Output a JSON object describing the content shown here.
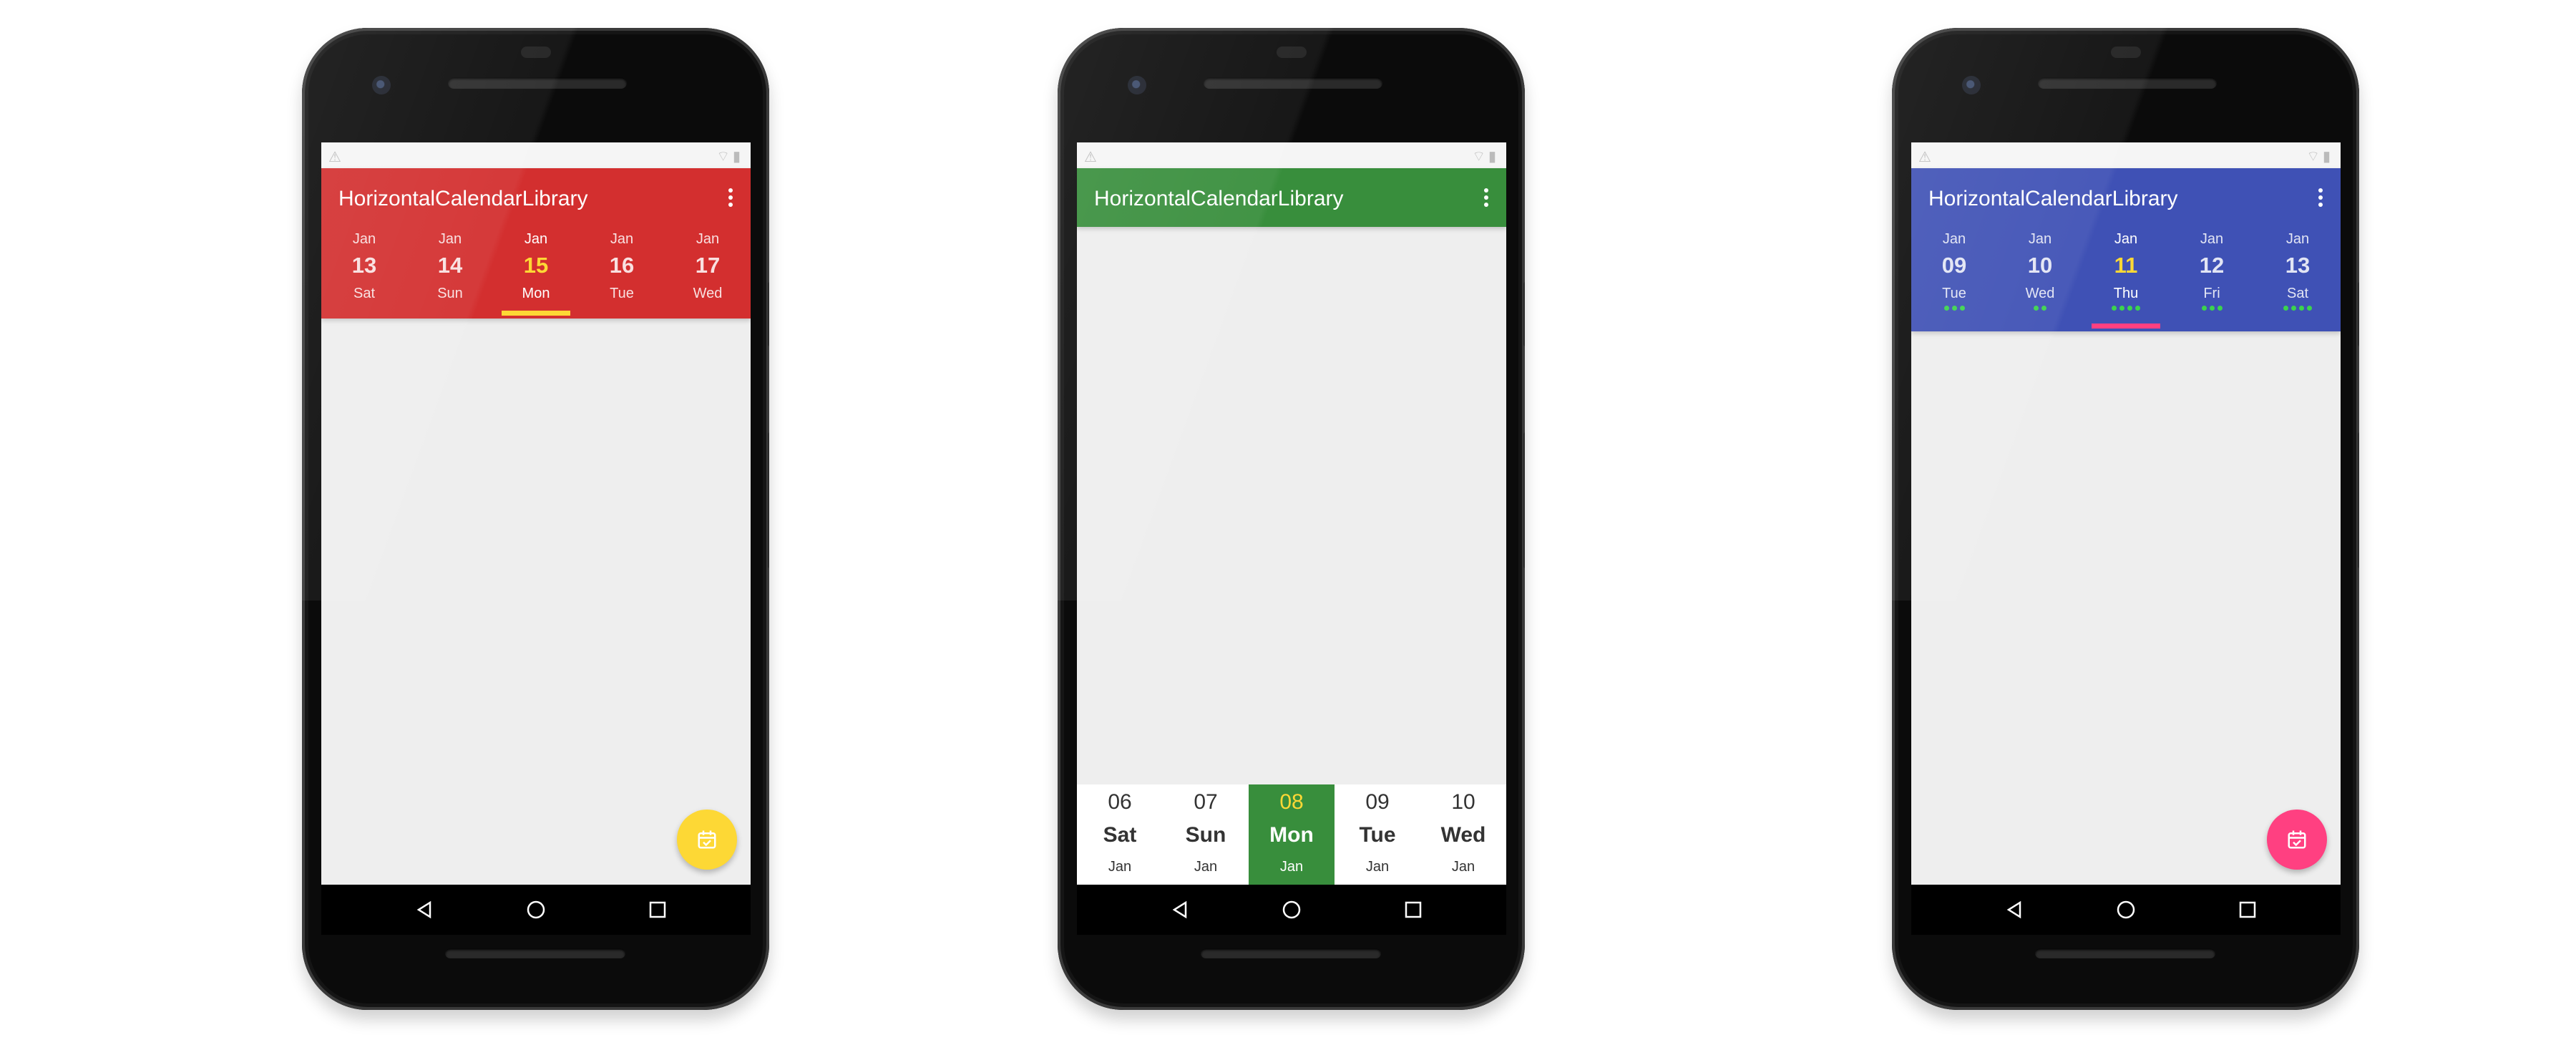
{
  "app_title": "HorizontalCalendarLibrary",
  "colors": {
    "red_primary": "#d32f2f",
    "green_primary": "#388e3c",
    "blue_primary": "#3f51b5",
    "yellow_accent": "#fdd835",
    "pink_accent": "#ff4081",
    "event_dot": "#3bd34d"
  },
  "status": {
    "warn_icon": "warning-icon",
    "right_icons": "wifi-icon battery-icon"
  },
  "phone1": {
    "days": [
      {
        "month": "Jan",
        "num": "13",
        "wd": "Sat",
        "selected": false
      },
      {
        "month": "Jan",
        "num": "14",
        "wd": "Sun",
        "selected": false
      },
      {
        "month": "Jan",
        "num": "15",
        "wd": "Mon",
        "selected": true
      },
      {
        "month": "Jan",
        "num": "16",
        "wd": "Tue",
        "selected": false
      },
      {
        "month": "Jan",
        "num": "17",
        "wd": "Wed",
        "selected": false
      }
    ],
    "fab_icon": "calendar-check-icon"
  },
  "phone2": {
    "days": [
      {
        "num": "06",
        "wd": "Sat",
        "month": "Jan",
        "selected": false
      },
      {
        "num": "07",
        "wd": "Sun",
        "month": "Jan",
        "selected": false
      },
      {
        "num": "08",
        "wd": "Mon",
        "month": "Jan",
        "selected": true
      },
      {
        "num": "09",
        "wd": "Tue",
        "month": "Jan",
        "selected": false
      },
      {
        "num": "10",
        "wd": "Wed",
        "month": "Jan",
        "selected": false
      }
    ]
  },
  "phone3": {
    "days": [
      {
        "month": "Jan",
        "num": "09",
        "wd": "Tue",
        "dots": 3,
        "selected": false
      },
      {
        "month": "Jan",
        "num": "10",
        "wd": "Wed",
        "dots": 2,
        "selected": false
      },
      {
        "month": "Jan",
        "num": "11",
        "wd": "Thu",
        "dots": 4,
        "selected": true
      },
      {
        "month": "Jan",
        "num": "12",
        "wd": "Fri",
        "dots": 3,
        "selected": false
      },
      {
        "month": "Jan",
        "num": "13",
        "wd": "Sat",
        "dots": 4,
        "selected": false
      }
    ],
    "fab_icon": "calendar-check-icon"
  }
}
